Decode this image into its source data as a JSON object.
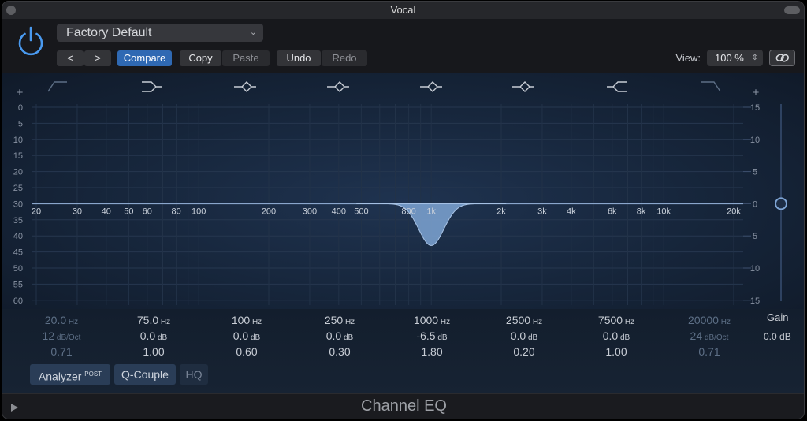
{
  "window": {
    "title": "Vocal"
  },
  "toolbar": {
    "preset": "Factory Default",
    "prev_label": "<",
    "next_label": ">",
    "compare_label": "Compare",
    "copy_label": "Copy",
    "paste_label": "Paste",
    "undo_label": "Undo",
    "redo_label": "Redo",
    "view_label": "View:",
    "view_value": "100 %"
  },
  "graph": {
    "plus_left": "+",
    "plus_right": "+",
    "db_scale_left": [
      "0",
      "5",
      "10",
      "15",
      "20",
      "25",
      "30",
      "35",
      "40",
      "45",
      "50",
      "55",
      "60"
    ],
    "gain_scale_right": [
      "15",
      "10",
      "5",
      "0",
      "5",
      "10",
      "15"
    ],
    "freq_labels": [
      "20",
      "30",
      "40",
      "50",
      "60",
      "80",
      "100",
      "200",
      "300",
      "400",
      "500",
      "800",
      "1k",
      "2k",
      "3k",
      "4k",
      "6k",
      "8k",
      "10k",
      "20k"
    ]
  },
  "bands": [
    {
      "freq": "20.0",
      "freq_unit": "Hz",
      "gain": "12",
      "gain_unit": "dB/Oct",
      "q": "0.71",
      "active": false
    },
    {
      "freq": "75.0",
      "freq_unit": "Hz",
      "gain": "0.0",
      "gain_unit": "dB",
      "q": "1.00",
      "active": true
    },
    {
      "freq": "100",
      "freq_unit": "Hz",
      "gain": "0.0",
      "gain_unit": "dB",
      "q": "0.60",
      "active": true
    },
    {
      "freq": "250",
      "freq_unit": "Hz",
      "gain": "0.0",
      "gain_unit": "dB",
      "q": "0.30",
      "active": true
    },
    {
      "freq": "1000",
      "freq_unit": "Hz",
      "gain": "-6.5",
      "gain_unit": "dB",
      "q": "1.80",
      "active": true
    },
    {
      "freq": "2500",
      "freq_unit": "Hz",
      "gain": "0.0",
      "gain_unit": "dB",
      "q": "0.20",
      "active": true
    },
    {
      "freq": "7500",
      "freq_unit": "Hz",
      "gain": "0.0",
      "gain_unit": "dB",
      "q": "1.00",
      "active": true
    },
    {
      "freq": "20000",
      "freq_unit": "Hz",
      "gain": "24",
      "gain_unit": "dB/Oct",
      "q": "0.71",
      "active": false
    }
  ],
  "gain": {
    "label": "Gain",
    "value": "0.0 dB"
  },
  "options": {
    "analyzer": "Analyzer",
    "analyzer_sup": "POST",
    "qcouple": "Q-Couple",
    "hq": "HQ"
  },
  "footer": {
    "plugin_name": "Channel EQ"
  },
  "colors": {
    "accent": "#2f69b3",
    "curve": "#7ea4d4"
  }
}
